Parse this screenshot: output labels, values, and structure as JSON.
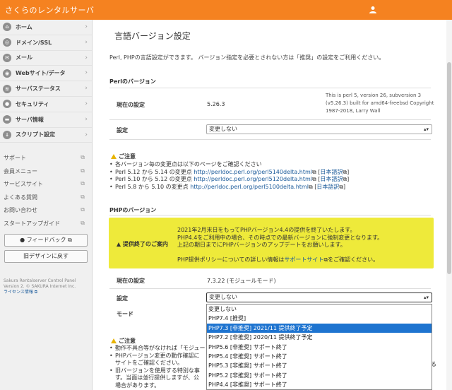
{
  "header": {
    "brand": "さくらのレンタルサーバ"
  },
  "sidebar": {
    "nav": [
      {
        "label": "ホーム",
        "icon": "home-icon",
        "glyph": "⌂"
      },
      {
        "label": "ドメイン/SSL",
        "icon": "globe-icon",
        "glyph": "◎"
      },
      {
        "label": "メール",
        "icon": "mail-icon",
        "glyph": "✉"
      },
      {
        "label": "Webサイト/データ",
        "icon": "web-icon",
        "glyph": "◉"
      },
      {
        "label": "サーバステータス",
        "icon": "status-icon",
        "glyph": "≋"
      },
      {
        "label": "セキュリティ",
        "icon": "lock-icon",
        "glyph": "●"
      },
      {
        "label": "サーバ情報",
        "icon": "server-icon",
        "glyph": "▬"
      },
      {
        "label": "スクリプト設定",
        "icon": "download-icon",
        "glyph": "↓"
      }
    ],
    "links": [
      "サポート",
      "会員メニュー",
      "サービスサイト",
      "よくある質問",
      "お問い合わせ",
      "スタートアップガイド"
    ],
    "feedback_button": "フィードバック",
    "old_design_button": "旧デザインに戻す",
    "footer_line1": "Sakura Rentalserver Control Panel",
    "footer_line2": "Version 2. © SAKURA Internet Inc.",
    "footer_license": "ライセンス情報"
  },
  "main": {
    "title": "言語バージョン設定",
    "intro": "Perl, PHPの言語設定ができます。 バージョン指定を必要とされない方は「推奨」の設定をご利用ください。",
    "perl": {
      "heading": "Perlのバージョン",
      "current_label": "現在の設定",
      "current_value": "5.26.3",
      "version_note": "This is perl 5, version 26, subversion 3 (v5.26.3) built for amd64-freebsd Copyright 1987-2018, Larry Wall",
      "setting_label": "設定",
      "setting_value": "変更しない"
    },
    "perl_notice": {
      "title": "ご注意",
      "line1": "各バージョン毎の変更点は以下のページをご確認ください",
      "items": [
        {
          "text": "Perl 5.12 から 5.14 の変更点 ",
          "url": "http://perldoc.perl.org/perl5140delta.html",
          "ja": "日本語訳"
        },
        {
          "text": "Perl 5.10 から 5.12 の変更点 ",
          "url": "http://perldoc.perl.org/perl5120delta.html",
          "ja": "日本語訳"
        },
        {
          "text": "Perl 5.8 から 5.10 の変更点 ",
          "url": "http://perldoc.perl.org/perl5100delta.html",
          "ja": "日本語訳"
        }
      ]
    },
    "php": {
      "heading": "PHPのバージョン",
      "eol_label": "提供終了のご案内",
      "eol_line1": "2021年2月末日をもってPHPバージョン4.4の提供を終了いたします。",
      "eol_line2": "PHP4.4をご利用中の場合、その時点での最新バージョンに強制変更となります。",
      "eol_line3": "上記の期日までにPHPバージョンのアップデートをお願いします。",
      "eol_line4_pre": "PHP提供ポリシーについての詳しい情報は",
      "eol_line4_link": "サポートサイト",
      "eol_line4_post": "をご確認ください。",
      "current_label": "現在の設定",
      "current_value": "7.3.22 (モジュールモード)",
      "setting_label": "設定",
      "setting_value": "変更しない",
      "mode_label": "モード",
      "options": [
        "変更しない",
        "PHP7.4 [推奨]",
        "PHP7.3 [非推奨] 2021/11 提供終了予定",
        "PHP7.2 [非推奨] 2020/11 提供終了予定",
        "PHP5.6 [非推奨] サポート終了",
        "PHP5.4 [非推奨] サポート終了",
        "PHP5.3 [非推奨] サポート終了",
        "PHP5.2 [非推奨] サポート終了",
        "PHP4.4 [非推奨] サポート終了"
      ],
      "highlighted_option": "PHP7.3 [非推奨] 2021/11 提供終了予定"
    },
    "php_notice": {
      "title": "ご注意",
      "line1": "動作不具合等がなければ「モジュー",
      "line2a": "PHPバージョン変更の動作確認に",
      "line2b": "サイトをご確認ください。",
      "line3a": "旧バージョンを使用する特別な事",
      "line3b": "す。当面は並行提供しますが、公",
      "line3c": "場合があります。",
      "side_char": "る"
    }
  },
  "colors": {
    "header": "#f58220",
    "sidebar_bg": "#f0f0f0",
    "notice_yellow": "#eeea3a",
    "selection": "#1e74d0",
    "link": "#1a5a9a"
  }
}
